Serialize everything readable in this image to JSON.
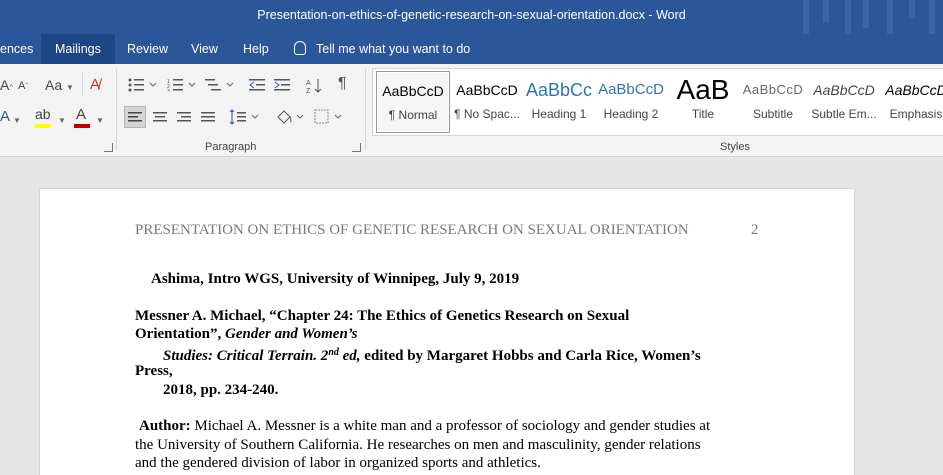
{
  "window": {
    "title": "Presentation-on-ethics-of-genetic-research-on-sexual-orientation.docx  -  Word"
  },
  "tabs": [
    {
      "label": "ences"
    },
    {
      "label": "Mailings"
    },
    {
      "label": "Review"
    },
    {
      "label": "View"
    },
    {
      "label": "Help"
    }
  ],
  "tellme": {
    "label": "Tell me what you want to do",
    "icon": "lightbulb-icon"
  },
  "ribbon": {
    "font_group": {
      "change_case": "Aa",
      "grow": "A",
      "shrink": "A"
    },
    "paragraph_label": "Paragraph",
    "styles_label": "Styles",
    "pilcrow": "¶",
    "highlight_color": "#ffff00",
    "font_color": "#c00000"
  },
  "styles": [
    {
      "preview": "AaBbCcD",
      "name": "¶ Normal"
    },
    {
      "preview": "AaBbCcD",
      "name": "¶ No Spac..."
    },
    {
      "preview": "AaBbCc",
      "name": "Heading 1"
    },
    {
      "preview": "AaBbCcD",
      "name": "Heading 2"
    },
    {
      "preview": "AaB",
      "name": "Title"
    },
    {
      "preview": "AaBbCcD",
      "name": "Subtitle"
    },
    {
      "preview": "AaBbCcD",
      "name": "Subtle Em..."
    },
    {
      "preview": "AaBbCcD",
      "name": "Emphasis"
    }
  ],
  "document": {
    "running_head": "PRESENTATION ON ETHICS OF GENETIC RESEARCH ON SEXUAL ORIENTATION",
    "page_number": "2",
    "author_line": "Ashima, Intro WGS, University of Winnipeg, July 9, 2019",
    "citation": {
      "line1": "Messner A. Michael, “Chapter 24: The Ethics of Genetics Research on Sexual",
      "line2a": "Orientation”, ",
      "line2b": "Gender and Women’s",
      "line3a": "Studies: Critical Terrain. 2",
      "line3sup": "nd",
      "line3b": " ed,",
      "line3c": " edited by Margaret Hobbs and Carla Rice, Women’s",
      "line4": "Press,",
      "line5": "2018, pp. 234-240."
    },
    "author_para": {
      "label": "Author:",
      "line1": " Michael A. Messner is a white man and a professor of sociology and gender studies at",
      "line2": "the University of Southern California. He researches on men and masculinity, gender relations",
      "line3": "and the gendered division of labor in organized sports and athletics."
    }
  },
  "colors": {
    "titlebar": "#2b579a",
    "active_tab": "#1d4685",
    "ribbon": "#f3f3f3",
    "canvas": "#e6e6e6",
    "heading1": "#2e74b5"
  }
}
